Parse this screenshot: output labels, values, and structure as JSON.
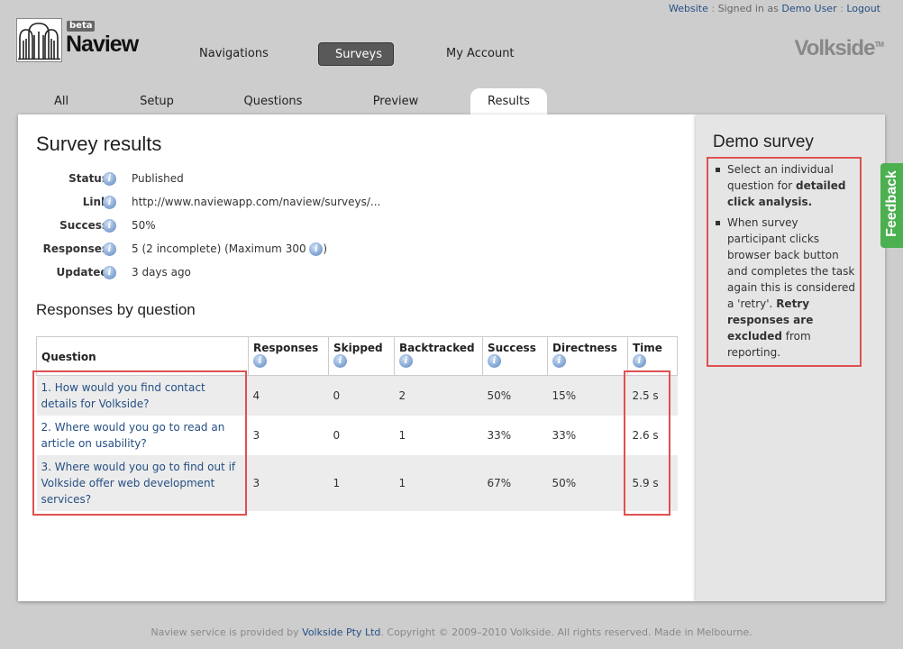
{
  "top_links": {
    "website": "Website",
    "sep1": ":",
    "signed_in_as": "Signed in as",
    "user": "Demo User",
    "sep2": ":",
    "logout": "Logout"
  },
  "logo": {
    "beta": "beta",
    "name": "Naview"
  },
  "main_nav": [
    {
      "label": "Navigations"
    },
    {
      "label": "Surveys",
      "active": true
    },
    {
      "label": "My Account"
    }
  ],
  "brand": {
    "name": "Volkside",
    "tm": "TM"
  },
  "sub_tabs": [
    {
      "label": "All"
    },
    {
      "label": "Setup"
    },
    {
      "label": "Questions"
    },
    {
      "label": "Preview"
    },
    {
      "label": "Results",
      "active": true
    }
  ],
  "page_title": "Survey results",
  "meta": {
    "status": {
      "label": "Status",
      "value": "Published"
    },
    "link": {
      "label": "Link",
      "value": "http://www.naviewapp.com/naview/surveys/..."
    },
    "success": {
      "label": "Success",
      "value": "50%"
    },
    "responses": {
      "label": "Responses",
      "value": "5 (2 incomplete) (Maximum 300",
      "suffix": ")"
    },
    "updated": {
      "label": "Updated",
      "value": "3 days ago"
    }
  },
  "section_title": "Responses by question",
  "table": {
    "headers": [
      "Question",
      "Responses",
      "Skipped",
      "Backtracked",
      "Success",
      "Directness",
      "Time"
    ],
    "rows": [
      {
        "question": "1. How would you find contact details for Volkside?",
        "responses": "4",
        "skipped": "0",
        "backtracked": "2",
        "success": "50%",
        "directness": "15%",
        "time": "2.5 s"
      },
      {
        "question": "2. Where would you go to read an article on usability?",
        "responses": "3",
        "skipped": "0",
        "backtracked": "1",
        "success": "33%",
        "directness": "33%",
        "time": "2.6 s"
      },
      {
        "question": "3. Where would you go to find out if Volkside offer web development services?",
        "responses": "3",
        "skipped": "1",
        "backtracked": "1",
        "success": "67%",
        "directness": "50%",
        "time": "5.9 s"
      }
    ]
  },
  "sidebar": {
    "title": "Demo survey",
    "tip1": {
      "text": "Select an individual question for ",
      "bold": "detailed click analysis."
    },
    "tip2": {
      "text": "When survey participant clicks browser back button and completes the task again this is considered a 'retry'. ",
      "bold": "Retry responses are excluded",
      "tail": " from reporting."
    }
  },
  "feedback_label": "Feedback",
  "footer": {
    "pre": "Naview service is provided by ",
    "company": "Volkside Pty Ltd",
    "post": ". Copyright © 2009–2010 Volkside. All rights reserved. Made in Melbourne."
  },
  "colors": {
    "background": "#cdcdcd",
    "link": "#254f84",
    "highlight": "#e05050",
    "feedback": "#4caf50",
    "active_nav": "#595959"
  }
}
